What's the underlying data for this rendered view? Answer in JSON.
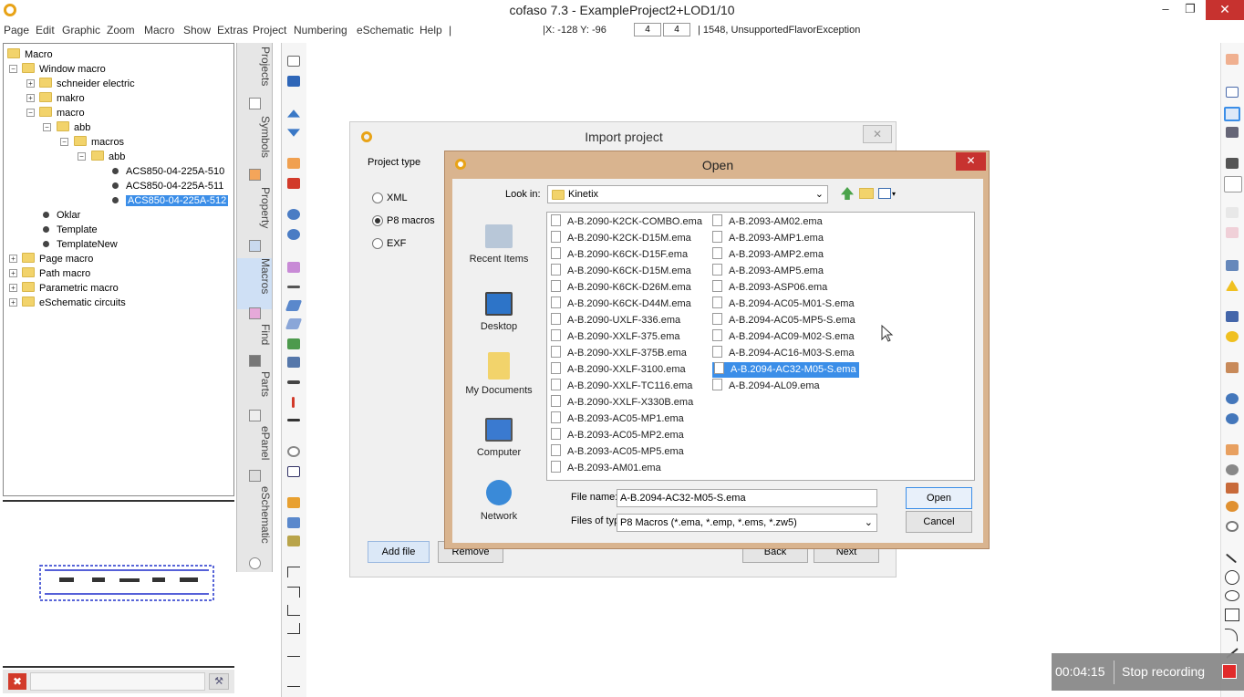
{
  "window": {
    "title": "cofaso 7.3 - ExampleProject2+LOD1/10",
    "minimize": "–",
    "maximize": "❐",
    "close": "✕"
  },
  "menu": [
    "Page",
    "Edit",
    "Graphic",
    "Zoom",
    "Macro",
    "Show",
    "Extras",
    "Project",
    "Numbering",
    "eSchematic",
    "Help",
    "|"
  ],
  "status": {
    "coords": "|X: -128    Y: -96",
    "grid_a": "4",
    "grid_b": "4",
    "message": "| 1548, UnsupportedFlavorException"
  },
  "tree": {
    "root": "Macro",
    "window_macro": "Window macro",
    "schneider": "schneider electric",
    "makro": "makro",
    "macro": "macro",
    "abb": "abb",
    "macros": "macros",
    "abb2": "abb",
    "item1": "ACS850-04-225A-510",
    "item2": "ACS850-04-225A-511",
    "item3": "ACS850-04-225A-512",
    "oklar": "Oklar",
    "template": "Template",
    "template_new": "TemplateNew",
    "page_macro": "Page macro",
    "path_macro": "Path macro",
    "parametric_macro": "Parametric macro",
    "eschematic": "eSchematic circuits"
  },
  "vtabs": [
    "Projects",
    "Symbols",
    "Property",
    "Macros",
    "Find",
    "Parts",
    "ePanel",
    "eSchematic"
  ],
  "import_dialog": {
    "title": "Import project",
    "close": "✕",
    "project_type_label": "Project type",
    "options": [
      "XML",
      "P8 macros",
      "EXF"
    ],
    "selected": "P8 macros",
    "add_file": "Add file",
    "remove": "Remove",
    "back": "Back",
    "next": "Next"
  },
  "open_dialog": {
    "title": "Open",
    "close": "✕",
    "look_in_label": "Look in:",
    "look_in_value": "Kinetix",
    "places": [
      "Recent Items",
      "Desktop",
      "My Documents",
      "Computer",
      "Network"
    ],
    "files_col1": [
      "A-B.2090-K2CK-COMBO.ema",
      "A-B.2090-K2CK-D15M.ema",
      "A-B.2090-K6CK-D15F.ema",
      "A-B.2090-K6CK-D15M.ema",
      "A-B.2090-K6CK-D26M.ema",
      "A-B.2090-K6CK-D44M.ema",
      "A-B.2090-UXLF-336.ema",
      "A-B.2090-XXLF-375.ema",
      "A-B.2090-XXLF-375B.ema",
      "A-B.2090-XXLF-3100.ema",
      "A-B.2090-XXLF-TC116.ema",
      "A-B.2090-XXLF-X330B.ema",
      "A-B.2093-AC05-MP1.ema",
      "A-B.2093-AC05-MP2.ema",
      "A-B.2093-AC05-MP5.ema",
      "A-B.2093-AM01.ema"
    ],
    "files_col2": [
      "A-B.2093-AM02.ema",
      "A-B.2093-AMP1.ema",
      "A-B.2093-AMP2.ema",
      "A-B.2093-AMP5.ema",
      "A-B.2093-ASP06.ema",
      "A-B.2094-AC05-M01-S.ema",
      "A-B.2094-AC05-MP5-S.ema",
      "A-B.2094-AC09-M02-S.ema",
      "A-B.2094-AC16-M03-S.ema",
      "A-B.2094-AC32-M05-S.ema",
      "A-B.2094-AL09.ema"
    ],
    "selected_file": "A-B.2094-AC32-M05-S.ema",
    "file_name_label": "File name:",
    "file_name_value": "A-B.2094-AC32-M05-S.ema",
    "files_of_type_label": "Files of type:",
    "files_of_type_value": "P8 Macros (*.ema, *.emp, *.ems, *.zw5)",
    "open": "Open",
    "cancel": "Cancel"
  },
  "recording": {
    "time": "00:04:15",
    "label": "Stop recording"
  },
  "colors": {
    "accent": "#3b8ee8",
    "close_red": "#c7322f",
    "open_frame": "#d9b48f",
    "folder": "#f2d36b",
    "logo": "#e8a317"
  }
}
